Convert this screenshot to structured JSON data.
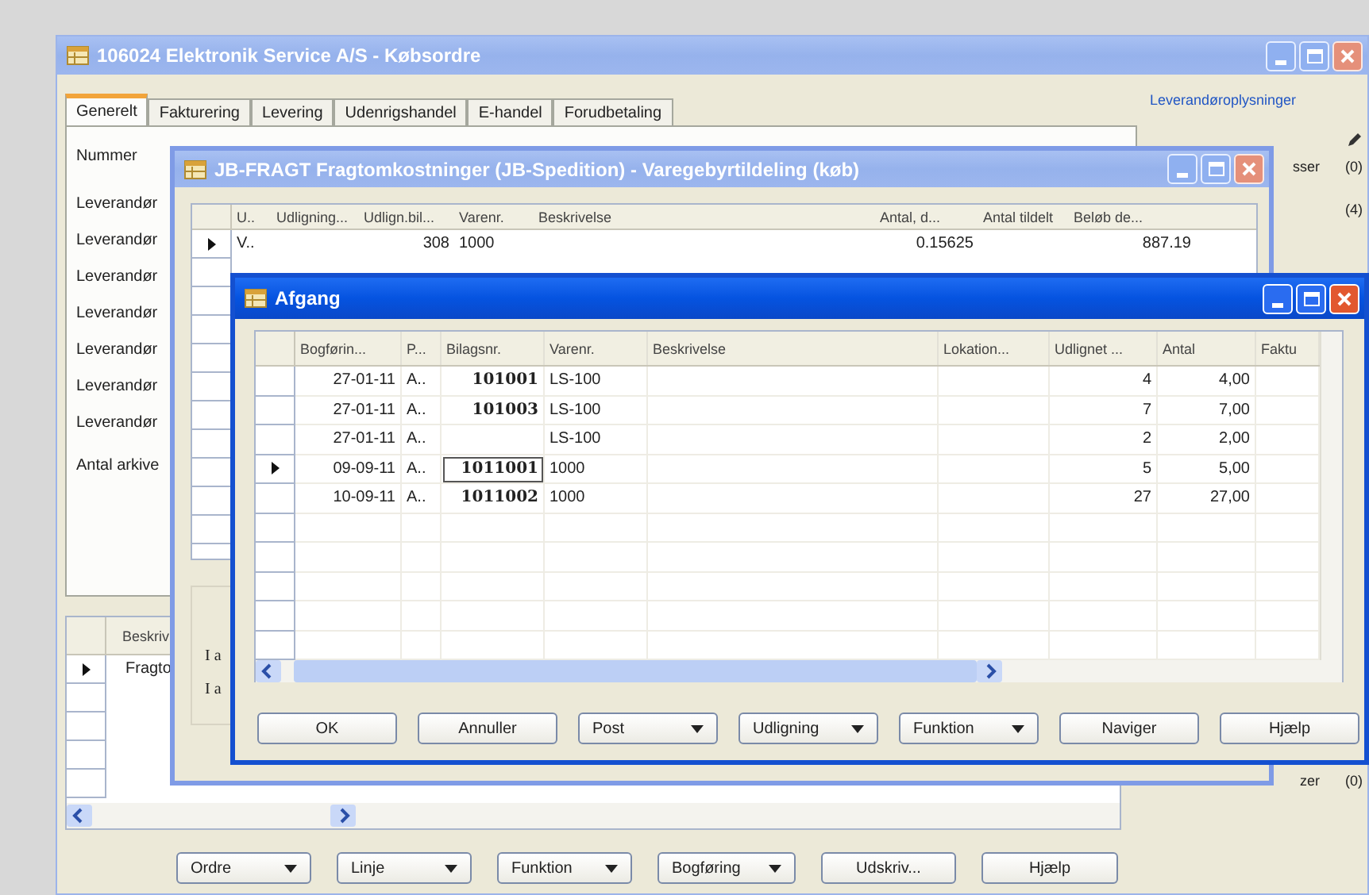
{
  "main_window": {
    "title": "106024 Elektronik Service A/S - Købsordre",
    "tabs": [
      {
        "label": "Generelt",
        "selected": true
      },
      {
        "label": "Fakturering",
        "selected": false
      },
      {
        "label": "Levering",
        "selected": false
      },
      {
        "label": "Udenrigshandel",
        "selected": false
      },
      {
        "label": "E-handel",
        "selected": false
      },
      {
        "label": "Forudbetaling",
        "selected": false
      }
    ],
    "field_labels": [
      "Nummer",
      "Leverandør",
      "Leverandør",
      "Leverandør",
      "Leverandør",
      "Leverandør",
      "Leverandør",
      "Leverandør",
      "Antal arkive"
    ],
    "side_panel": {
      "heading": "Leverandøroplysninger",
      "rows": [
        {
          "label": "sser",
          "value": "(0)"
        },
        {
          "value": "(4)"
        }
      ],
      "footer_row": {
        "label": "zer",
        "value": "(0)"
      }
    },
    "lines_table": {
      "columns": [
        "Beskriv"
      ],
      "rows": [
        {
          "cells": [
            "Fragto"
          ],
          "selected": true
        }
      ]
    },
    "buttons": [
      {
        "label": "Ordre",
        "kind": "dropdown"
      },
      {
        "label": "Linje",
        "kind": "dropdown"
      },
      {
        "label": "Funktion",
        "kind": "dropdown"
      },
      {
        "label": "Bogføring",
        "kind": "dropdown"
      },
      {
        "label": "Udskriv...",
        "kind": "plain"
      },
      {
        "label": "Hjælp",
        "kind": "plain"
      }
    ]
  },
  "fragt_window": {
    "title": "JB-FRAGT Fragtomkostninger (JB-Spedition) - Varegebyrtildeling (køb)",
    "columns": [
      "U..",
      "Udligning...",
      "Udlign.bil...",
      "Varenr.",
      "Beskrivelse",
      "Antal, d...",
      "Antal tildelt",
      "Beløb de..."
    ],
    "rows": [
      {
        "u": "V..",
        "applied_doc": "308",
        "item_no": "1000",
        "qty": "0.15625",
        "amount": "887.19",
        "selected": true
      }
    ],
    "side_labels": [
      "I a",
      "I a"
    ]
  },
  "afgang_window": {
    "title": "Afgang",
    "columns": [
      "Bogførin...",
      "P...",
      "Bilagsnr.",
      "Varenr.",
      "Beskrivelse",
      "Lokation...",
      "Udlignet ...",
      "Antal",
      "Faktu"
    ],
    "rows": [
      {
        "date": "27-01-11",
        "type": "A..",
        "doc": "101001",
        "item": "LS-100",
        "applied": "4",
        "qty": "4,00",
        "selected": false
      },
      {
        "date": "27-01-11",
        "type": "A..",
        "doc": "101003",
        "item": "LS-100",
        "applied": "7",
        "qty": "7,00",
        "selected": false
      },
      {
        "date": "27-01-11",
        "type": "A..",
        "item": "LS-100",
        "applied": "2",
        "qty": "2,00",
        "selected": false
      },
      {
        "date": "09-09-11",
        "type": "A..",
        "doc": "1011001",
        "item": "1000",
        "applied": "5",
        "qty": "5,00",
        "selected": true
      },
      {
        "date": "10-09-11",
        "type": "A..",
        "doc": "1011002",
        "item": "1000",
        "applied": "27",
        "qty": "27,00",
        "selected": false
      }
    ],
    "buttons": [
      {
        "label": "OK",
        "kind": "plain"
      },
      {
        "label": "Annuller",
        "kind": "plain"
      },
      {
        "label": "Post",
        "kind": "dropdown"
      },
      {
        "label": "Udligning",
        "kind": "dropdown"
      },
      {
        "label": "Funktion",
        "kind": "dropdown"
      },
      {
        "label": "Naviger",
        "kind": "plain"
      },
      {
        "label": "Hjælp",
        "kind": "plain"
      }
    ]
  }
}
